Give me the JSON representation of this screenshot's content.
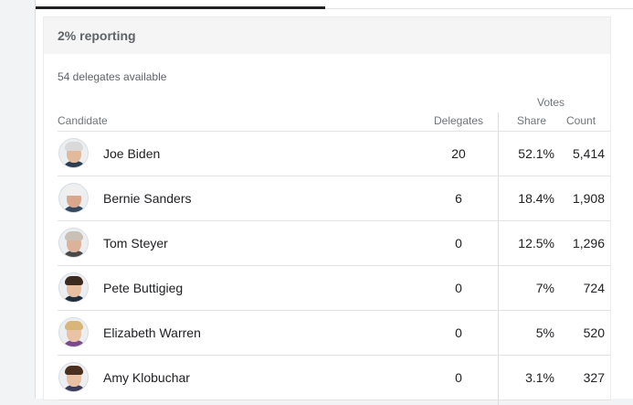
{
  "header": {
    "reporting": "2% reporting"
  },
  "subtitle": "54 delegates available",
  "columns": {
    "votes": "Votes",
    "candidate": "Candidate",
    "delegates": "Delegates",
    "share": "Share",
    "count": "Count"
  },
  "candidates": [
    {
      "name": "Joe Biden",
      "delegates": "20",
      "share": "52.1%",
      "count": "5,414",
      "skin": "#e2b99a",
      "hair": "#d9d9d9",
      "suit": "#2c3e50"
    },
    {
      "name": "Bernie Sanders",
      "delegates": "6",
      "share": "18.4%",
      "count": "1,908",
      "skin": "#d9a88c",
      "hair": "#efefef",
      "suit": "#34495e"
    },
    {
      "name": "Tom Steyer",
      "delegates": "0",
      "share": "12.5%",
      "count": "1,296",
      "skin": "#dcb39a",
      "hair": "#c9c1b5",
      "suit": "#4a4a4a"
    },
    {
      "name": "Pete Buttigieg",
      "delegates": "0",
      "share": "7%",
      "count": "724",
      "skin": "#e5bfa0",
      "hair": "#3b2a1f",
      "suit": "#1f2d3d"
    },
    {
      "name": "Elizabeth Warren",
      "delegates": "0",
      "share": "5%",
      "count": "520",
      "skin": "#eac2a5",
      "hair": "#d8b67a",
      "suit": "#7a4a8c"
    },
    {
      "name": "Amy Klobuchar",
      "delegates": "0",
      "share": "3.1%",
      "count": "327",
      "skin": "#e8c0a3",
      "hair": "#4a2e1e",
      "suit": "#3b3b5c"
    }
  ]
}
